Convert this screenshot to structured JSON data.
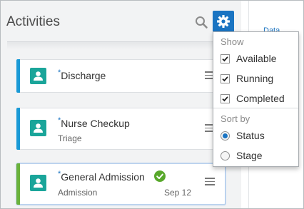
{
  "header": {
    "title": "Activities"
  },
  "icons": {
    "search": "search-icon",
    "settings": "gear-icon",
    "avatar": "person-id-icon",
    "menu": "hamburger-icon",
    "status": "check-circle-icon"
  },
  "colors": {
    "accent": "#1a74c2",
    "avatar": "#1aa59a",
    "bar_blue": "#1a9ad6",
    "bar_green": "#6bb23b",
    "complete": "#58a82b"
  },
  "activities": [
    {
      "title": "Discharge",
      "required_marker": "*",
      "subtitle": "",
      "date": ""
    },
    {
      "title": "Nurse Checkup",
      "required_marker": "*",
      "subtitle": "Triage",
      "date": ""
    },
    {
      "title": "General Admission",
      "required_marker": "*",
      "subtitle": "Admission",
      "date": "Sep 12",
      "completed": true
    }
  ],
  "right_panel": {
    "label": "Data"
  },
  "dropdown": {
    "show_heading": "Show",
    "show_options": [
      {
        "label": "Available",
        "checked": true
      },
      {
        "label": "Running",
        "checked": true
      },
      {
        "label": "Completed",
        "checked": true
      }
    ],
    "sort_heading": "Sort by",
    "sort_options": [
      {
        "label": "Status",
        "selected": true
      },
      {
        "label": "Stage",
        "selected": false
      }
    ]
  }
}
